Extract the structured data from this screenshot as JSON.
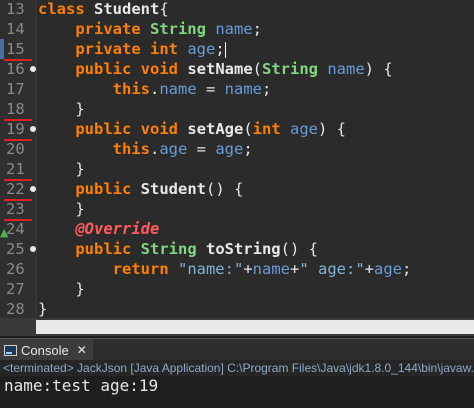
{
  "editor": {
    "lines": [
      {
        "n": "13",
        "tokens": [
          [
            "kw",
            "class "
          ],
          [
            "mn",
            "Student"
          ],
          [
            "plain",
            "{"
          ]
        ]
      },
      {
        "n": "14",
        "tokens": [
          [
            "plain",
            "    "
          ],
          [
            "kw",
            "private "
          ],
          [
            "ty",
            "String "
          ],
          [
            "fld",
            "name"
          ],
          [
            "plain",
            ";"
          ]
        ]
      },
      {
        "n": "15",
        "tokens": [
          [
            "plain",
            "    "
          ],
          [
            "kw",
            "private "
          ],
          [
            "kw",
            "int "
          ],
          [
            "fld",
            "age"
          ],
          [
            "plain",
            ";"
          ]
        ],
        "caret": true
      },
      {
        "n": "16",
        "tokens": [
          [
            "plain",
            "    "
          ],
          [
            "kw",
            "public "
          ],
          [
            "kw",
            "void "
          ],
          [
            "mn",
            "setName"
          ],
          [
            "plain",
            "("
          ],
          [
            "ty",
            "String "
          ],
          [
            "fld",
            "name"
          ],
          [
            "plain",
            ") {"
          ]
        ]
      },
      {
        "n": "17",
        "tokens": [
          [
            "plain",
            "        "
          ],
          [
            "kw",
            "this"
          ],
          [
            "plain",
            "."
          ],
          [
            "fld",
            "name"
          ],
          [
            "plain",
            " = "
          ],
          [
            "fld",
            "name"
          ],
          [
            "plain",
            ";"
          ]
        ]
      },
      {
        "n": "18",
        "tokens": [
          [
            "plain",
            "    }"
          ]
        ]
      },
      {
        "n": "19",
        "tokens": [
          [
            "plain",
            "    "
          ],
          [
            "kw",
            "public "
          ],
          [
            "kw",
            "void "
          ],
          [
            "mn",
            "setAge"
          ],
          [
            "plain",
            "("
          ],
          [
            "kw",
            "int "
          ],
          [
            "fld",
            "age"
          ],
          [
            "plain",
            ") {"
          ]
        ]
      },
      {
        "n": "20",
        "tokens": [
          [
            "plain",
            "        "
          ],
          [
            "kw",
            "this"
          ],
          [
            "plain",
            "."
          ],
          [
            "fld",
            "age"
          ],
          [
            "plain",
            " = "
          ],
          [
            "fld",
            "age"
          ],
          [
            "plain",
            ";"
          ]
        ]
      },
      {
        "n": "21",
        "tokens": [
          [
            "plain",
            "    }"
          ]
        ]
      },
      {
        "n": "22",
        "tokens": [
          [
            "plain",
            "    "
          ],
          [
            "kw",
            "public "
          ],
          [
            "mn",
            "Student"
          ],
          [
            "plain",
            "() {"
          ]
        ]
      },
      {
        "n": "23",
        "tokens": [
          [
            "plain",
            "    }"
          ]
        ]
      },
      {
        "n": "24",
        "tokens": [
          [
            "plain",
            "    "
          ],
          [
            "ann",
            "@Override"
          ]
        ]
      },
      {
        "n": "25",
        "tokens": [
          [
            "plain",
            "    "
          ],
          [
            "kw",
            "public "
          ],
          [
            "ty",
            "String "
          ],
          [
            "mn",
            "toString"
          ],
          [
            "plain",
            "() {"
          ]
        ]
      },
      {
        "n": "26",
        "tokens": [
          [
            "plain",
            "        "
          ],
          [
            "kw",
            "return "
          ],
          [
            "str",
            "\"name:\""
          ],
          [
            "plain",
            "+"
          ],
          [
            "fld",
            "name"
          ],
          [
            "plain",
            "+"
          ],
          [
            "str",
            "\" age:\""
          ],
          [
            "plain",
            "+"
          ],
          [
            "fld",
            "age"
          ],
          [
            "plain",
            ";"
          ]
        ]
      },
      {
        "n": "27",
        "tokens": [
          [
            "plain",
            "    }"
          ]
        ]
      },
      {
        "n": "28",
        "tokens": [
          [
            "plain",
            "}"
          ]
        ]
      }
    ]
  },
  "console": {
    "tab_label": "Console",
    "close_symbol": "✕",
    "status": "<terminated> JackJson [Java Application] C:\\Program Files\\Java\\jdk1.8.0_144\\bin\\javaw.",
    "output": "name:test age:19"
  }
}
